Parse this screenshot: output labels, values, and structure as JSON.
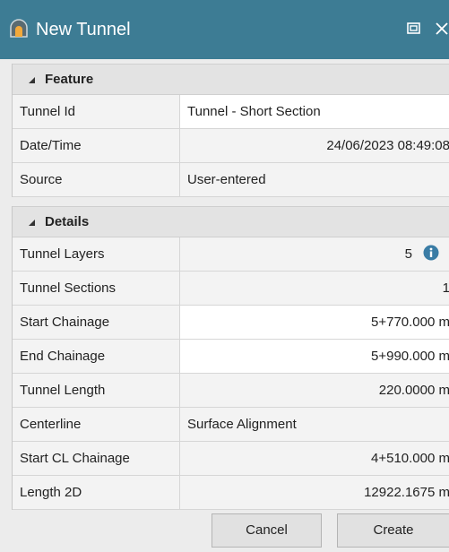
{
  "window": {
    "title": "New Tunnel",
    "accent": "#3d7c94"
  },
  "sections": {
    "feature": {
      "header": "Feature",
      "rows": [
        {
          "label": "Tunnel Id",
          "value": "Tunnel - Short Section"
        },
        {
          "label": "Date/Time",
          "value": "24/06/2023 08:49:08"
        },
        {
          "label": "Source",
          "value": "User-entered"
        }
      ]
    },
    "details": {
      "header": "Details",
      "rows": [
        {
          "label": "Tunnel Layers",
          "value": "5"
        },
        {
          "label": "Tunnel Sections",
          "value": "1"
        },
        {
          "label": "Start Chainage",
          "value": "5+770.000 m"
        },
        {
          "label": "End Chainage",
          "value": "5+990.000 m"
        },
        {
          "label": "Tunnel Length",
          "value": "220.0000 m"
        },
        {
          "label": "Centerline",
          "value": "Surface Alignment"
        },
        {
          "label": "Start CL Chainage",
          "value": "4+510.000 m"
        },
        {
          "label": "Length 2D",
          "value": "12922.1675 m"
        }
      ]
    }
  },
  "buttons": {
    "cancel": "Cancel",
    "create": "Create"
  },
  "icons": {
    "app": "tunnel-icon",
    "restore": "restore-window-icon",
    "close": "close-icon",
    "info": "info-icon"
  }
}
